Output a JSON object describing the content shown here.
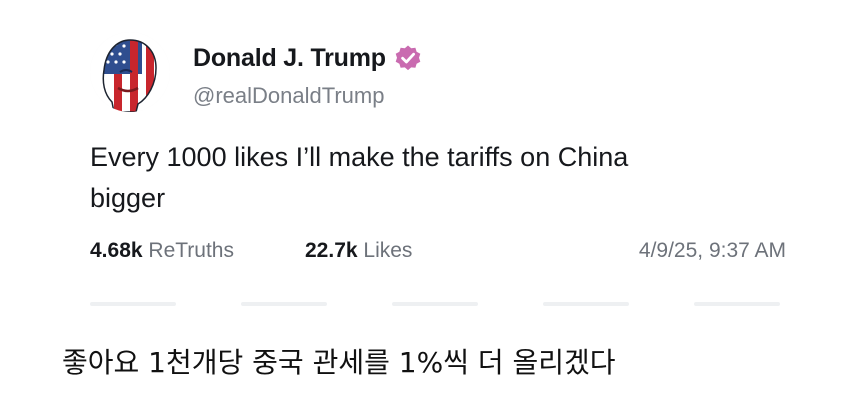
{
  "post": {
    "author": {
      "display_name": "Donald J. Trump",
      "handle": "@realDonaldTrump",
      "verified": true,
      "avatar_icon": "flag-portrait-avatar-icon",
      "badge_icon": "verified-badge-icon",
      "badge_color": "#c96bb0"
    },
    "text_line1": "Every 1000 likes I’ll make the tariffs on China",
    "text_line2": "bigger",
    "stats": {
      "retruths_count": "4.68k",
      "retruths_label": "ReTruths",
      "likes_count": "22.7k",
      "likes_label": "Likes"
    },
    "timestamp": "4/9/25, 9:37 AM"
  },
  "caption": "좋아요 1천개당 중국 관세를 1%씩 더 올리겠다"
}
